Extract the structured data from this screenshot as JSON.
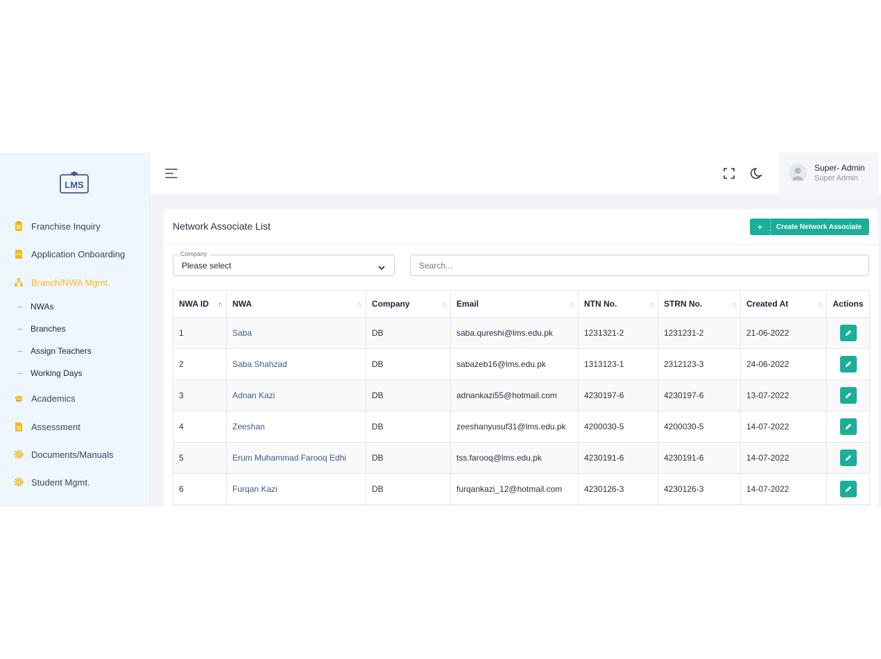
{
  "app": {
    "logo_text": "LMS"
  },
  "sidebar": {
    "items": [
      {
        "label": "Franchise Inquiry",
        "icon": "clipboard-icon"
      },
      {
        "label": "Application Onboarding",
        "icon": "document-icon"
      },
      {
        "label": "Branch/NWA Mgmt.",
        "icon": "sitemap-icon",
        "active": true
      },
      {
        "label": "Academics",
        "icon": "graduation-cap-icon"
      },
      {
        "label": "Assessment",
        "icon": "document-icon"
      },
      {
        "label": "Documents/Manuals",
        "icon": "gear-icon"
      },
      {
        "label": "Student Mgmt.",
        "icon": "gear-icon"
      }
    ],
    "subitems": [
      "NWAs",
      "Branches",
      "Assign Teachers",
      "Working Days"
    ]
  },
  "header": {
    "icons": [
      "menu-icon",
      "fullscreen-icon",
      "moon-icon"
    ],
    "user": {
      "name": "Super- Admin",
      "role": "Super Admin"
    }
  },
  "main": {
    "title": "Network Associate List",
    "create_button": {
      "plus": "+",
      "label": "Create Network Associate"
    },
    "company_filter": {
      "legend": "Company",
      "value": "Please select"
    },
    "search": {
      "placeholder": "Search..."
    },
    "table": {
      "columns": [
        "NWA ID",
        "NWA",
        "Company",
        "Email",
        "NTN No.",
        "STRN No.",
        "Created At",
        "Actions"
      ],
      "rows": [
        {
          "id": "1",
          "nwa": "Saba",
          "company": "DB",
          "email": "saba.qureshi@lms.edu.pk",
          "ntn": "1231321-2",
          "strn": "1231231-2",
          "created": "21-06-2022"
        },
        {
          "id": "2",
          "nwa": "Saba Shahzad",
          "company": "DB",
          "email": "sabazeb16@lms.edu.pk",
          "ntn": "1313123-1",
          "strn": "2312123-3",
          "created": "24-06-2022"
        },
        {
          "id": "3",
          "nwa": "Adnan Kazi",
          "company": "DB",
          "email": "adnankazi55@hotmail.com",
          "ntn": "4230197-6",
          "strn": "4230197-6",
          "created": "13-07-2022"
        },
        {
          "id": "4",
          "nwa": "Zeeshan",
          "company": "DB",
          "email": "zeeshanyusuf31@lms.edu.pk",
          "ntn": "4200030-5",
          "strn": "4200030-5",
          "created": "14-07-2022"
        },
        {
          "id": "5",
          "nwa": "Erum Muhammad Farooq Edhi",
          "company": "DB",
          "email": "tss.farooq@lms.edu.pk",
          "ntn": "4230191-6",
          "strn": "4230191-6",
          "created": "14-07-2022"
        },
        {
          "id": "6",
          "nwa": "Furqan Kazi",
          "company": "DB",
          "email": "furqankazi_12@hotmail.com",
          "ntn": "4230126-3",
          "strn": "4230126-3",
          "created": "14-07-2022"
        },
        {
          "id": "",
          "nwa": "",
          "company": "",
          "email": "",
          "ntn": "",
          "strn": "",
          "created": ""
        }
      ]
    }
  },
  "colors": {
    "accent": "#1cae98",
    "active_nav": "#f4bd1a",
    "sidebar_bg": "#eef6ff"
  }
}
